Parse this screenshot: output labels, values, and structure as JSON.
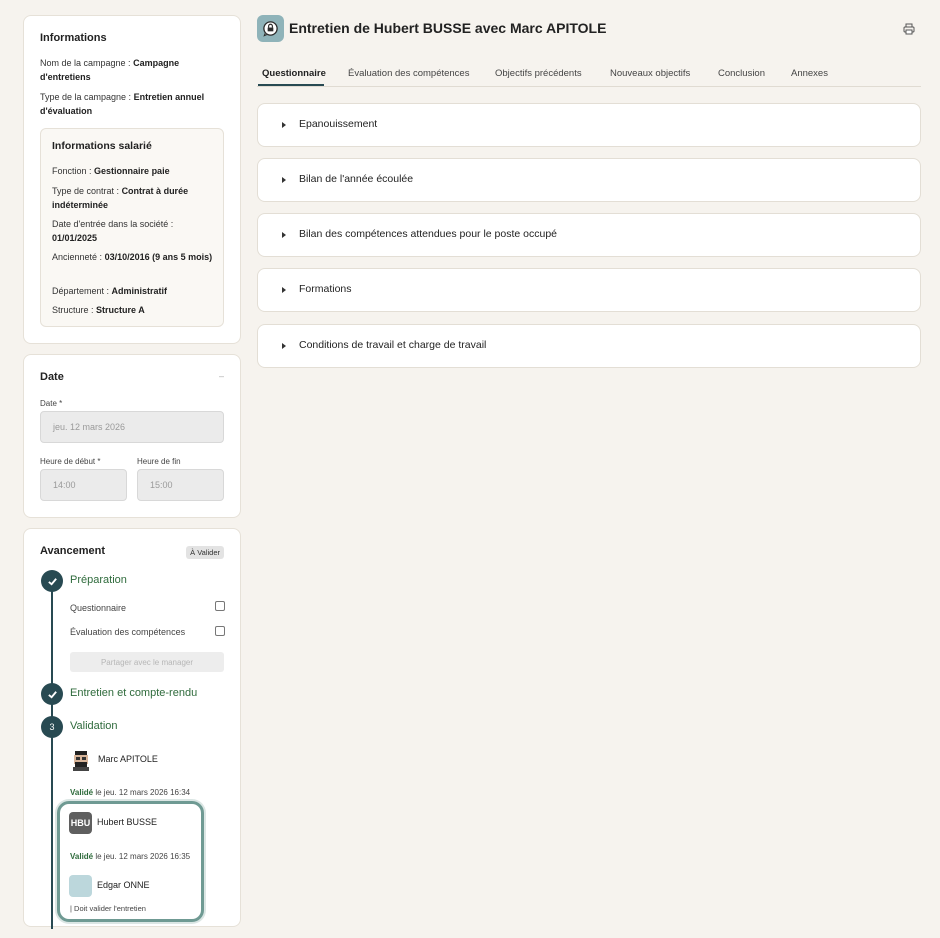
{
  "header": {
    "title": "Entretien de Hubert BUSSE avec Marc APITOLE"
  },
  "tabs": [
    {
      "label": "Questionnaire"
    },
    {
      "label": "Évaluation des compétences"
    },
    {
      "label": "Objectifs précédents"
    },
    {
      "label": "Nouveaux objectifs"
    },
    {
      "label": "Conclusion"
    },
    {
      "label": "Annexes"
    }
  ],
  "sections": [
    {
      "label": "Epanouissement"
    },
    {
      "label": "Bilan de l'année écoulée"
    },
    {
      "label": "Bilan des compétences attendues pour le poste occupé"
    },
    {
      "label": "Formations"
    },
    {
      "label": "Conditions de travail et charge de travail"
    }
  ],
  "infos": {
    "title": "Informations",
    "campaign_name_label": "Nom de la campagne :",
    "campaign_name_value": "Campagne d'entretiens",
    "campaign_type_label": "Type de la campagne :",
    "campaign_type_value": "Entretien annuel d'évaluation",
    "employee": {
      "title": "Informations salarié",
      "fonction_label": "Fonction :",
      "fonction_value": "Gestionnaire paie",
      "contrat_label": "Type de contrat :",
      "contrat_value": "Contrat à durée indéterminée",
      "entree_label": "Date d'entrée dans la société :",
      "entree_value": "01/01/2025",
      "anciennete_label": "Ancienneté :",
      "anciennete_value": "03/10/2016 (9 ans 5 mois)",
      "departement_label": "Département :",
      "departement_value": "Administratif",
      "structure_label": "Structure :",
      "structure_value": "Structure A"
    }
  },
  "date_card": {
    "title": "Date",
    "collapse_glyph": "–",
    "date_label": "Date *",
    "date_value": "jeu. 12 mars 2026",
    "start_label": "Heure de début *",
    "start_value": "14:00",
    "end_label": "Heure de fin",
    "end_value": "15:00"
  },
  "progress": {
    "title": "Avancement",
    "badge": "À Valider",
    "step1": "Préparation",
    "step1_items": [
      "Questionnaire",
      "Évaluation des compétences"
    ],
    "share_button": "Partager avec le manager",
    "step2": "Entretien et compte-rendu",
    "step3_number": "3",
    "step3": "Validation",
    "validators": [
      {
        "name": "Marc APITOLE",
        "status": "Validé",
        "date": "le jeu. 12 mars 2026 16:34"
      },
      {
        "initials": "HBU",
        "name": "Hubert BUSSE",
        "status": "Validé",
        "date": "le jeu. 12 mars 2026 16:35"
      },
      {
        "name": "Edgar ONNE",
        "note": "| Doit valider l'entretien"
      }
    ]
  },
  "colors": {
    "accent_dark": "#284a52",
    "green_text": "#2f6b3c",
    "highlight_border": "#6f9a93"
  }
}
